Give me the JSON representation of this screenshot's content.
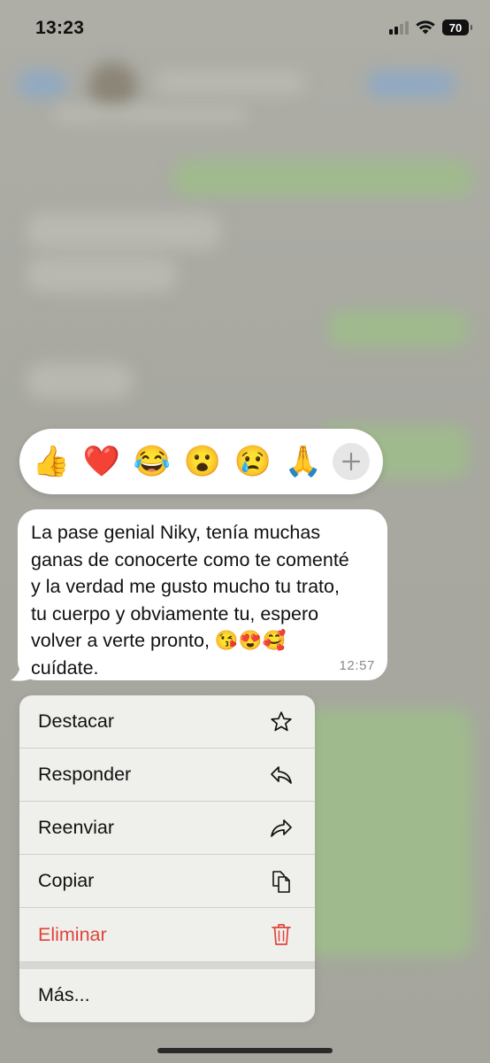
{
  "status_bar": {
    "time": "13:23",
    "battery": "70"
  },
  "reactions": [
    {
      "emoji": "👍",
      "name": "thumbs-up"
    },
    {
      "emoji": "❤️",
      "name": "red-heart"
    },
    {
      "emoji": "😂",
      "name": "tears-of-joy"
    },
    {
      "emoji": "😮",
      "name": "surprised"
    },
    {
      "emoji": "😢",
      "name": "crying"
    },
    {
      "emoji": "🙏",
      "name": "folded-hands"
    }
  ],
  "message": {
    "text": "La pase genial Niky, tenía muchas\nganas de conocerte como te comenté\ny la verdad me gusto mucho tu trato,\ntu cuerpo y obviamente tu, espero\nvolver a verte pronto, 😘😍🥰\ncuídate.",
    "time": "12:57"
  },
  "menu": {
    "destacar": "Destacar",
    "responder": "Responder",
    "reenviar": "Reenviar",
    "copiar": "Copiar",
    "eliminar": "Eliminar",
    "mas": "Más..."
  },
  "colors": {
    "destructive": "#e0443b",
    "bubble": "#ffffff",
    "menu_background": "#efefec"
  },
  "icons": {
    "star": "star-icon",
    "reply": "reply-icon",
    "forward": "forward-icon",
    "copy": "copy-icon",
    "delete": "trash-icon",
    "add_reaction": "plus-icon"
  }
}
